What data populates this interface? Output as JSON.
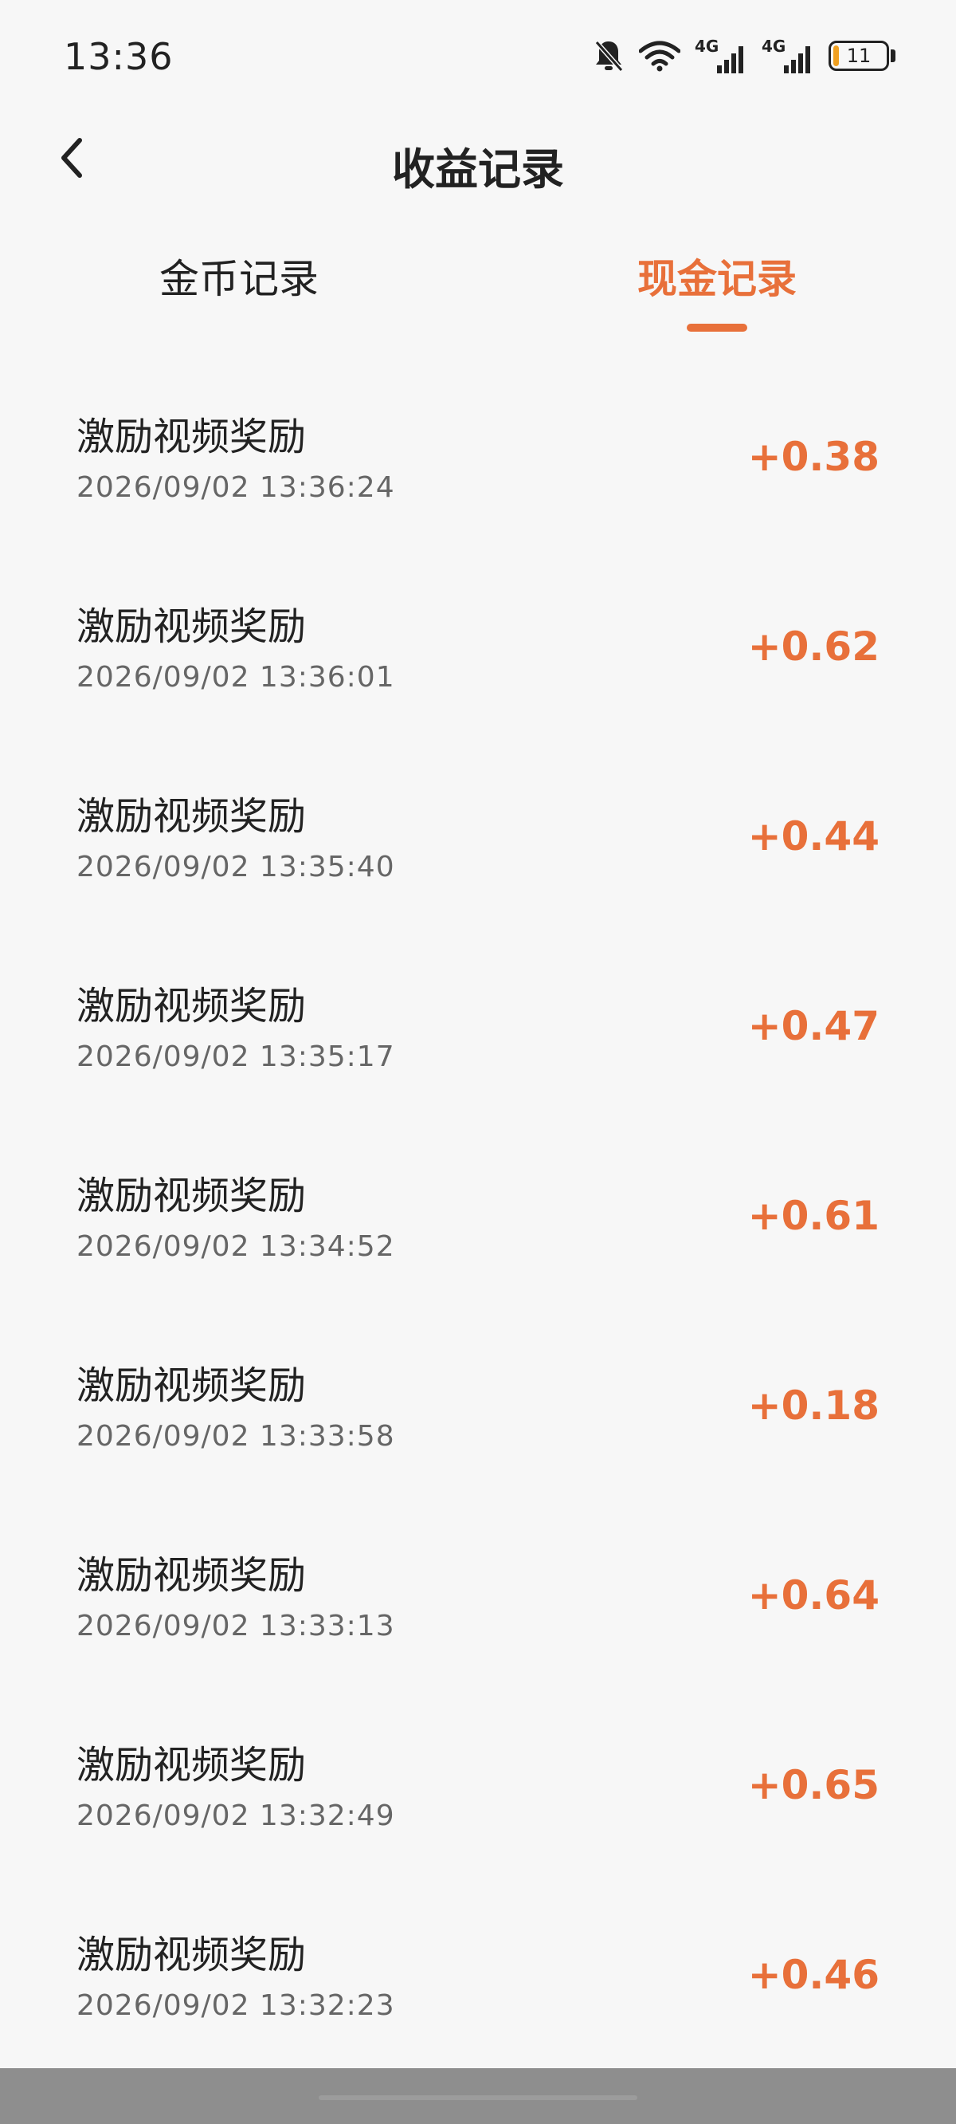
{
  "status_bar": {
    "time": "13:36",
    "network_1": "4G",
    "network_2": "4G",
    "battery_level": "11",
    "battery_fraction": 0.11,
    "icons": [
      "bell-muted-icon",
      "wifi-icon",
      "signal-icon",
      "signal-icon",
      "battery-icon"
    ]
  },
  "header": {
    "title": "收益记录",
    "back_icon": "chevron-left-icon"
  },
  "tabs": [
    {
      "label": "金币记录",
      "active": false
    },
    {
      "label": "现金记录",
      "active": true
    }
  ],
  "records": [
    {
      "title": "激励视频奖励",
      "time": "2026/09/02 13:36:24",
      "amount": "+0.38"
    },
    {
      "title": "激励视频奖励",
      "time": "2026/09/02 13:36:01",
      "amount": "+0.62"
    },
    {
      "title": "激励视频奖励",
      "time": "2026/09/02 13:35:40",
      "amount": "+0.44"
    },
    {
      "title": "激励视频奖励",
      "time": "2026/09/02 13:35:17",
      "amount": "+0.47"
    },
    {
      "title": "激励视频奖励",
      "time": "2026/09/02 13:34:52",
      "amount": "+0.61"
    },
    {
      "title": "激励视频奖励",
      "time": "2026/09/02 13:33:58",
      "amount": "+0.18"
    },
    {
      "title": "激励视频奖励",
      "time": "2026/09/02 13:33:13",
      "amount": "+0.64"
    },
    {
      "title": "激励视频奖励",
      "time": "2026/09/02 13:32:49",
      "amount": "+0.65"
    },
    {
      "title": "激励视频奖励",
      "time": "2026/09/02 13:32:23",
      "amount": "+0.46"
    }
  ],
  "colors": {
    "accent": "#e8703a",
    "background": "#f7f7f7",
    "text_primary": "#222222",
    "text_secondary": "#666666",
    "battery": "#f0a020"
  }
}
